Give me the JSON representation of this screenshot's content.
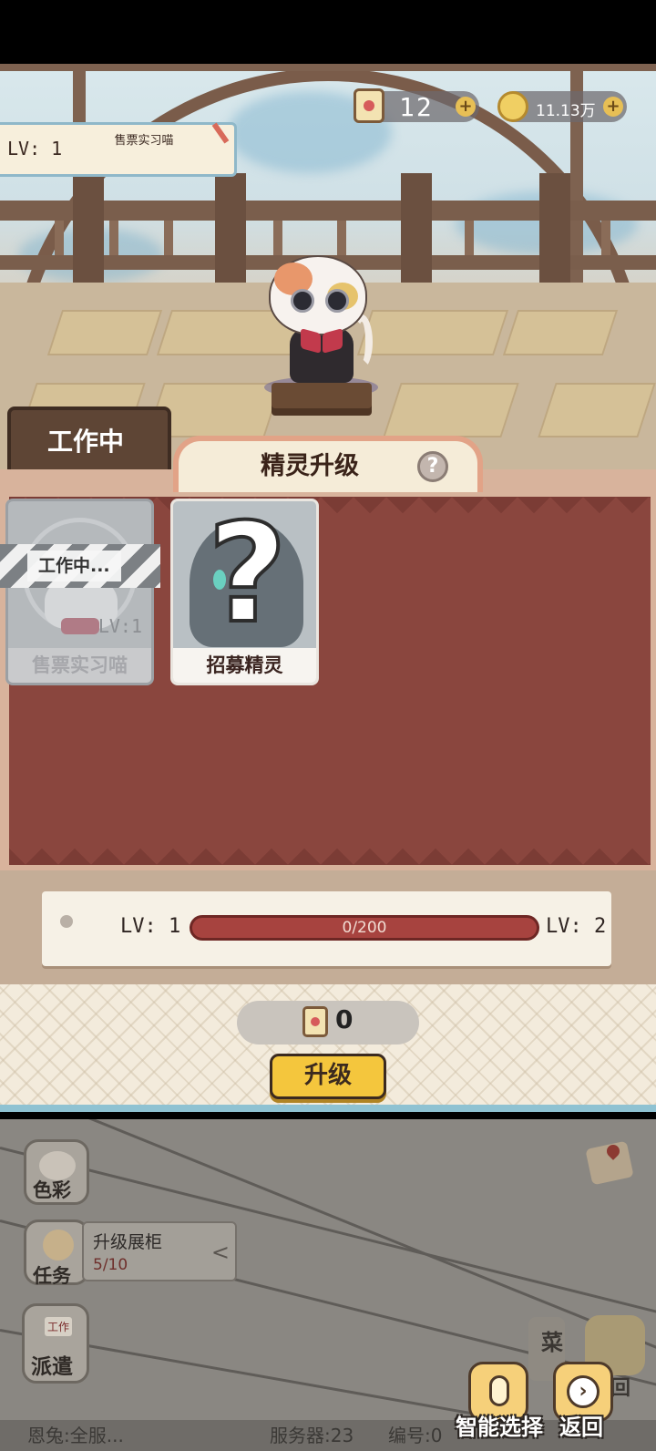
{
  "hud": {
    "tickets": "12",
    "coins": "11.13万",
    "plus": "+"
  },
  "character": {
    "level": "LV: 1",
    "name": "售票实习喵"
  },
  "tabs": {
    "working": "工作中"
  },
  "panel": {
    "title": "精灵升级",
    "help": "?"
  },
  "cards": [
    {
      "name": "售票实习喵",
      "level": "LV:1",
      "status": "工作中..."
    },
    {
      "name": "招募精灵",
      "symbol": "?"
    }
  ],
  "progress": {
    "from": "LV: 1",
    "to": "LV: 2",
    "text": "0/200",
    "current": 0,
    "max": 200
  },
  "cost": {
    "value": "0"
  },
  "upgrade_label": "升级",
  "side_buttons": {
    "color": "色彩",
    "tasks": "任务",
    "dispatch": "派遣",
    "dispatch_badge": "工作"
  },
  "task": {
    "title": "升级展柜",
    "progress": "5/10",
    "chevron": "<"
  },
  "menu_partial": {
    "menu": "菜",
    "back": "回"
  },
  "bottom_bar": {
    "chat": "恩兔:全服...",
    "server": "服务器:23",
    "number": "编号:0"
  },
  "actions": {
    "smart_select": "智能选择",
    "return": "返回"
  },
  "colors": {
    "panel_bg": "#8a463e",
    "upgrade_button": "#f4c63d",
    "progress_track": "#a7433f"
  }
}
